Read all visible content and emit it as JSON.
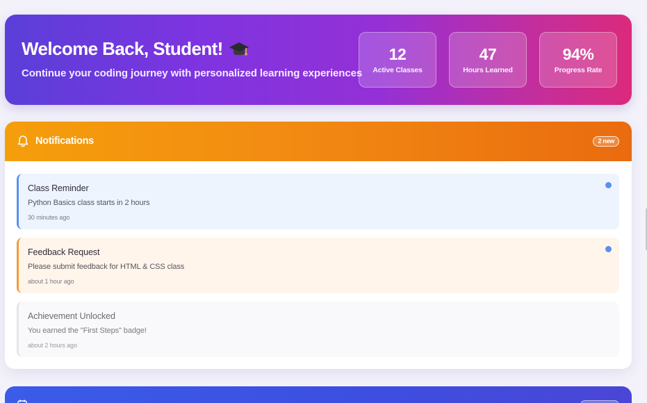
{
  "hero": {
    "title": "Welcome Back, Student!",
    "title_icon": "graduation-cap-icon",
    "subtitle": "Continue your coding journey with personalized learning experiences",
    "stats": [
      {
        "value": "12",
        "label": "Active Classes"
      },
      {
        "value": "47",
        "label": "Hours Learned"
      },
      {
        "value": "94%",
        "label": "Progress Rate"
      }
    ]
  },
  "notifications": {
    "icon": "bell-icon",
    "title": "Notifications",
    "badge": "2 new",
    "items": [
      {
        "title": "Class Reminder",
        "description": "Python Basics class starts in 2 hours",
        "time": "30 minutes ago",
        "unread": true,
        "accent": "#5b8ff0"
      },
      {
        "title": "Feedback Request",
        "description": "Please submit feedback for HTML & CSS class",
        "time": "about 1 hour ago",
        "unread": true,
        "accent": "#f39b3b"
      },
      {
        "title": "Achievement Unlocked",
        "description": "You earned the \"First Steps\" badge!",
        "time": "about 2 hours ago",
        "unread": false,
        "accent": "#e4e4ea"
      }
    ]
  },
  "next_panel": {
    "icon": "calendar-icon"
  },
  "colors": {
    "hero_gradient_start": "#5a3fd8",
    "hero_gradient_end": "#db2a7c",
    "notif_header_start": "#f59e0c",
    "notif_header_end": "#ea6b0f",
    "next_panel": "#3a5ce8",
    "unread_dot": "#5b8ff0"
  }
}
